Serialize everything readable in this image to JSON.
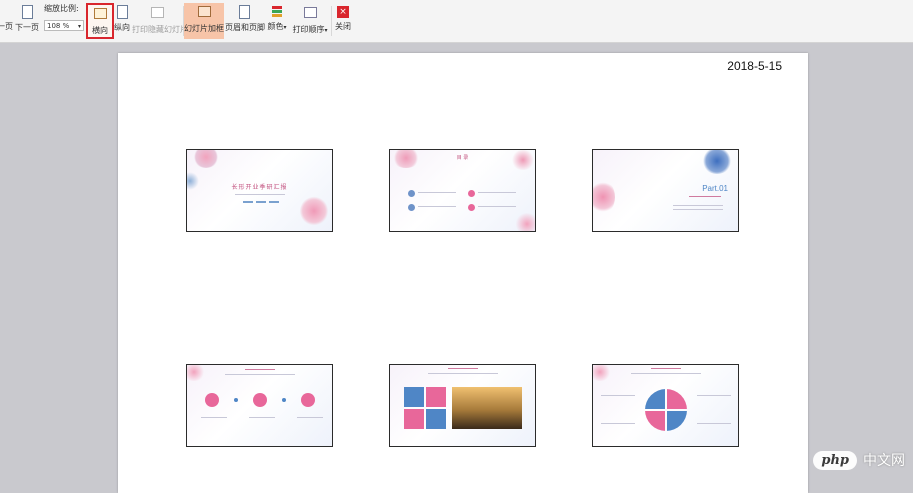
{
  "toolbar": {
    "prev_page": "一页",
    "next_page": "下一页",
    "zoom_label": "缩放比例:",
    "zoom_value": "108 %",
    "landscape": "横向",
    "portrait": "纵向",
    "print_hidden": "打印隐藏幻灯片",
    "frame_slides": "幻灯片加框",
    "header_footer": "页眉和页脚",
    "color": "颜色",
    "print_order": "打印顺序",
    "close": "关闭"
  },
  "page": {
    "date": "2018-5-15"
  },
  "slides": [
    {
      "title": "长形开业季研汇报"
    },
    {
      "title": "目 录"
    },
    {
      "title": "Part.01"
    },
    {
      "title": ""
    },
    {
      "title": ""
    },
    {
      "title": ""
    }
  ],
  "watermark": {
    "logo": "php",
    "text": "中文网"
  },
  "colors": {
    "highlight_border": "#d9262d",
    "active_button_bg": "#f7c4a8",
    "pink": "#e8679a",
    "blue": "#4f86c6"
  }
}
